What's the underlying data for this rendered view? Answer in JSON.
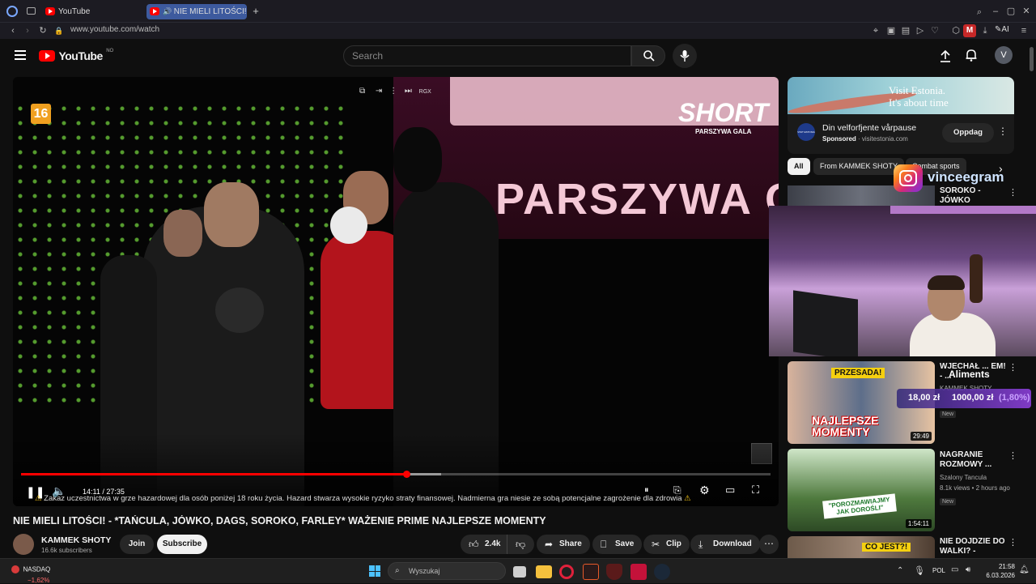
{
  "browser": {
    "tabs": [
      {
        "label": "YouTube"
      },
      {
        "label": "NIE MIELI LITOŚCI! - *"
      }
    ],
    "address": "www.youtube.com/watch",
    "ai_label": "AI"
  },
  "header": {
    "logo": "YouTube",
    "logo_region": "NO",
    "search_placeholder": "Search",
    "avatar_letter": "V"
  },
  "player": {
    "age_badge": "16",
    "brand_overlay": "SHORT",
    "brand_overlay_sub": "PARSZYWA GALA",
    "banner_text": "PARSZYWA G",
    "rgx_label": "RGX",
    "time": "14:11 / 27:35",
    "progress": 0.514,
    "buffered": 0.56,
    "disclaimer": "Zakaz uczestnictwa w grze hazardowej dla osób poniżej 18 roku życia. Hazard stwarza wysokie ryzyko straty finansowej. Nadmierna gra niesie ze sobą potencjalne zagrożenie dla zdrowia"
  },
  "video": {
    "title": "NIE MIELI LITOŚCI! - *TAŃCULA, JÓWKO, DAGS, SOROKO, FARLEY* WAŻENIE PRIME NAJLEPSZE MOMENTY",
    "channel": "KAMMEK SHOTY",
    "subscribers": "16.6k subscribers",
    "join_label": "Join",
    "subscribe_label": "Subscribe",
    "likes": "2.4k",
    "share_label": "Share",
    "save_label": "Save",
    "clip_label": "Clip",
    "download_label": "Download"
  },
  "ad": {
    "banner_line1": "Visit Estonia.",
    "banner_line2": "It's about time",
    "title": "Din velforfjente vårpause",
    "sponsored": "Sponsored",
    "domain": "visitestonia.com",
    "cta": "Oppdag",
    "logo_text": "VISIT ESTONIA"
  },
  "chips": [
    "All",
    "From KAMMEK SHOTY",
    "Combat sports"
  ],
  "overlay": {
    "instagram_handle": "vinceegram",
    "stock_label": "Aliments",
    "price1": "18,00 zł",
    "price2": "1000,00 zł",
    "change": "(1,80%)"
  },
  "recommendations": [
    {
      "title": "SOROKO - JÓWKO ZABIERA MOJĄ ...",
      "channel": "",
      "meta": "",
      "badge": "",
      "duration": ""
    },
    {
      "title": "WJECHAŁ ... EM! - ...",
      "channel": "KAMMEK SHOTY",
      "meta": "",
      "badge": "New",
      "duration": "29:49",
      "thumb_text1": "PRZESADA!",
      "thumb_text2": "NAJLEPSZE MOMENTY"
    },
    {
      "title": "NAGRANIE ROZMOWY ...",
      "channel": "Szalony Tancula",
      "meta": "8.1k views • 2 hours ago",
      "badge": "New",
      "duration": "1:54:11",
      "thumb_text1": "\"POROZMAWIAJMY JAK DOROŚLI\""
    },
    {
      "title": "NIE DOJDZIE DO WALKI? - *FARL...",
      "channel": "",
      "meta": "",
      "badge": "",
      "duration": "",
      "thumb_text1": "CO JEST?!"
    }
  ],
  "taskbar": {
    "ticker_name": "NASDAQ",
    "ticker_change": "−1,62%",
    "search_placeholder": "Wyszukaj",
    "language": "POL",
    "time": "21:58",
    "date": "6.03.2026"
  },
  "colors": {
    "youtube_red": "#ff0000",
    "progress_red": "#f00",
    "dot_green": "#6fce3c",
    "instagram_pink": "#e1306c",
    "overlay_purple": "#8b3fd9"
  }
}
